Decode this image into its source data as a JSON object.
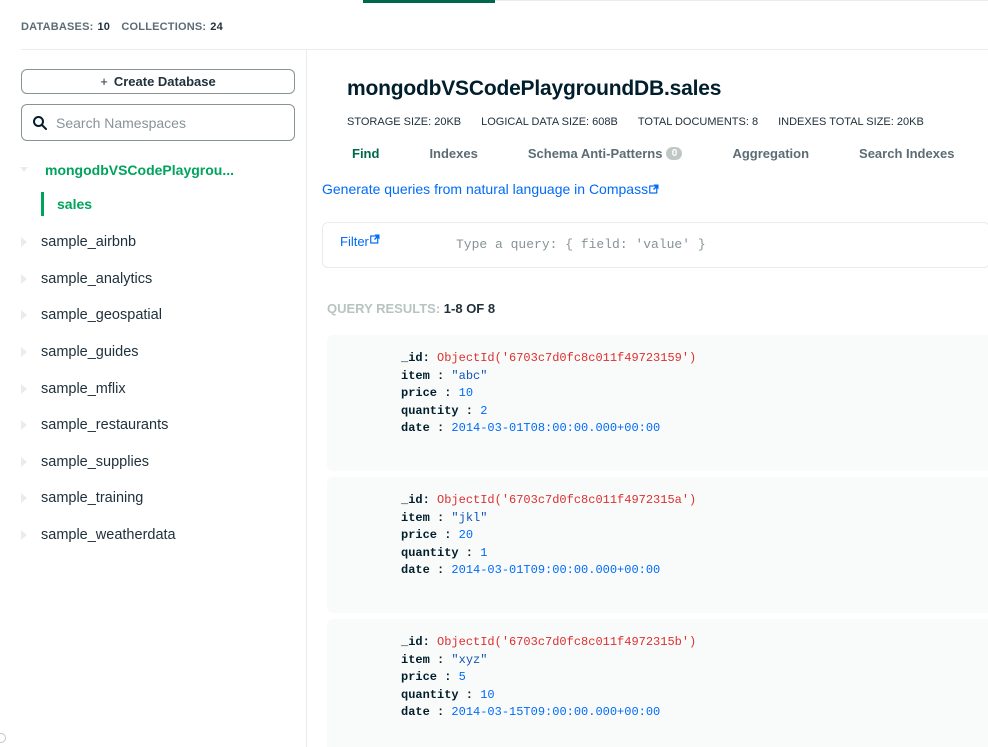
{
  "stats": {
    "databases_label": "DATABASES:",
    "databases_count": "10",
    "collections_label": "COLLECTIONS:",
    "collections_count": "24"
  },
  "sidebar": {
    "create_button": "Create Database",
    "search_placeholder": "Search Namespaces",
    "active_db": "mongodbVSCodePlaygrou...",
    "active_collection": "sales",
    "databases": [
      "sample_airbnb",
      "sample_analytics",
      "sample_geospatial",
      "sample_guides",
      "sample_mflix",
      "sample_restaurants",
      "sample_supplies",
      "sample_training",
      "sample_weatherdata"
    ]
  },
  "main": {
    "namespace": "mongodbVSCodePlaygroundDB.sales",
    "storage_size": "STORAGE SIZE: 20KB",
    "logical_size": "LOGICAL DATA SIZE: 608B",
    "total_docs": "TOTAL DOCUMENTS: 8",
    "indexes_size": "INDEXES TOTAL SIZE: 20KB",
    "tabs": [
      "Find",
      "Indexes",
      "Schema Anti-Patterns",
      "Aggregation",
      "Search Indexes"
    ],
    "schema_badge": "0",
    "nl_link": "Generate queries from natural language in Compass",
    "filter_label": "Filter",
    "filter_placeholder": "Type a query: { field: 'value' }",
    "results_label": "QUERY RESULTS:",
    "results_count": "1-8 OF 8"
  },
  "documents": [
    {
      "id": "ObjectId('6703c7d0fc8c011f49723159')",
      "item": "\"abc\"",
      "price": "10",
      "quantity": "2",
      "date": "2014-03-01T08:00:00.000+00:00"
    },
    {
      "id": "ObjectId('6703c7d0fc8c011f4972315a')",
      "item": "\"jkl\"",
      "price": "20",
      "quantity": "1",
      "date": "2014-03-01T09:00:00.000+00:00"
    },
    {
      "id": "ObjectId('6703c7d0fc8c011f4972315b')",
      "item": "\"xyz\"",
      "price": "5",
      "quantity": "10",
      "date": "2014-03-15T09:00:00.000+00:00"
    }
  ],
  "field_keys": {
    "id": "_id",
    "item": "item",
    "price": "price",
    "quantity": "quantity",
    "date": "date"
  },
  "colors": {
    "accent": "#00a35c",
    "link": "#016bf8",
    "objectid": "#db3030"
  }
}
